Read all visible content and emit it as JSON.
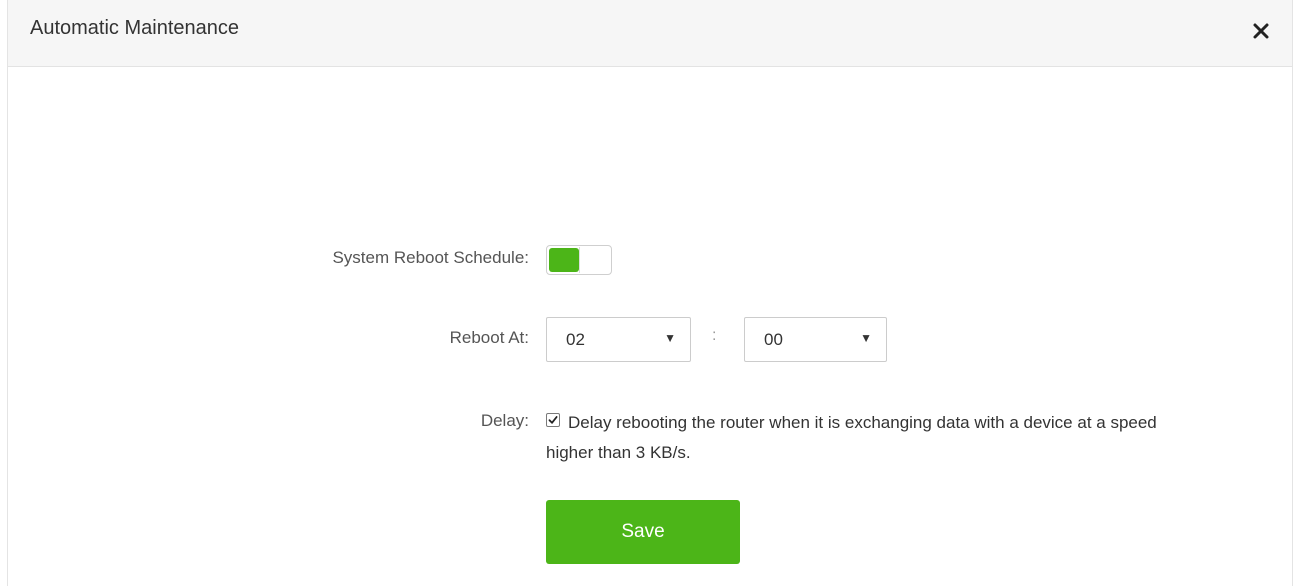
{
  "dialog": {
    "title": "Automatic Maintenance"
  },
  "form": {
    "reboot_schedule": {
      "label": "System Reboot Schedule:",
      "enabled": true
    },
    "reboot_at": {
      "label": "Reboot At:",
      "hour": "02",
      "minute": "00",
      "separator": ":"
    },
    "delay": {
      "label": "Delay:",
      "checked": true,
      "text": "Delay rebooting the router when it is exchanging data with a device at a speed higher than 3 KB/s."
    },
    "save_label": "Save"
  },
  "colors": {
    "accent": "#4cb518",
    "header_bg": "#f6f6f6"
  },
  "icons": {
    "close": "close-icon",
    "dropdown": "chevron-down-icon",
    "check": "checkmark-icon"
  }
}
